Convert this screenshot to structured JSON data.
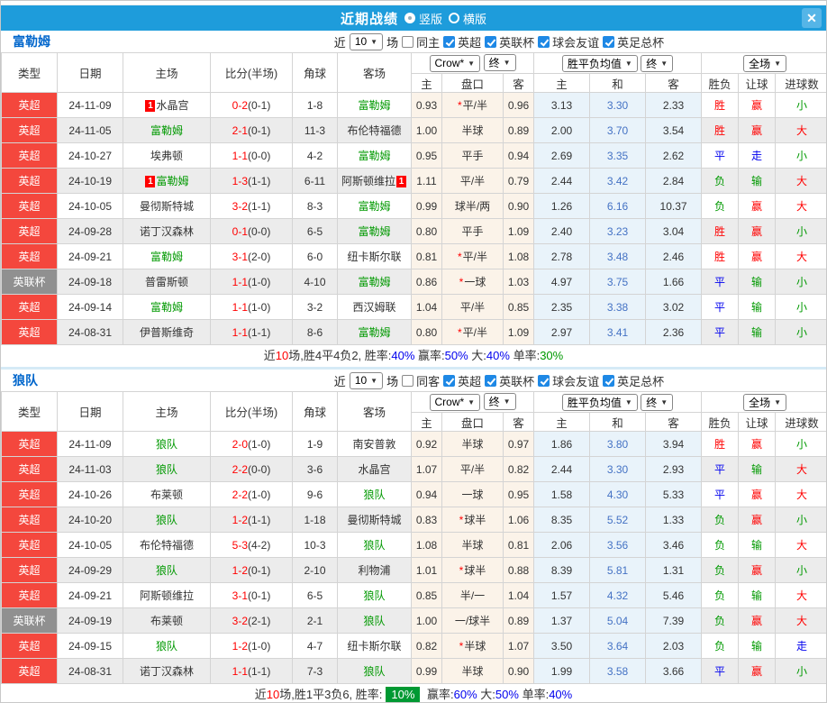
{
  "window": {
    "title": "近期战绩",
    "close_glyph": "✕",
    "layouts": [
      {
        "label": "竖版",
        "selected": true
      },
      {
        "label": "横版",
        "selected": false
      }
    ]
  },
  "colors": {
    "title_bar_blue": "#1e9cdb",
    "league_red": "#f4473d",
    "cup_gray": "#909090",
    "focus_team_green": "#009900",
    "score_red": "#ff0000",
    "result_blue": "#0000ee",
    "avg_col_bg": "#e9f3fa",
    "odds_col_bg": "#fbf3e9",
    "summary_highlight_bg": "#009933"
  },
  "table": {
    "main_cols": [
      "类型",
      "日期",
      "主场",
      "比分(半场)",
      "角球",
      "客场"
    ],
    "sub_cols": [
      "主",
      "盘口",
      "客",
      "主",
      "和",
      "客",
      "胜负",
      "让球",
      "进球数"
    ],
    "selects": {
      "company": "Crow*",
      "company_time": "终",
      "avg": "胜平负均值",
      "avg_time": "终",
      "scope": "全场"
    }
  },
  "type_styles": {
    "英超": "league",
    "英联杯": "cup"
  },
  "result_colors": {
    "胜": "red",
    "平": "blue",
    "负": "green",
    "赢": "red",
    "走": "blue",
    "输": "green",
    "大": "red",
    "小": "green"
  },
  "sections": [
    {
      "team": "富勒姆",
      "filter": {
        "near_label": "近",
        "count": "10",
        "unit_label": "场",
        "same_label": "同主",
        "same_checked": false,
        "competitions": [
          {
            "label": "英超",
            "checked": true
          },
          {
            "label": "英联杯",
            "checked": true
          },
          {
            "label": "球会友谊",
            "checked": true
          },
          {
            "label": "英足总杯",
            "checked": true
          }
        ]
      },
      "rows": [
        {
          "type": "英超",
          "date": "24-11-09",
          "home": "水晶宫",
          "home_green": false,
          "home_badge": "1",
          "score": "0-2",
          "half": "(0-1)",
          "corners": "1-8",
          "away": "富勒姆",
          "away_green": true,
          "odds": [
            "0.93",
            "*平/半",
            "0.96"
          ],
          "avg": [
            "3.13",
            "3.30",
            "2.33"
          ],
          "results": [
            "胜",
            "赢",
            "小"
          ]
        },
        {
          "type": "英超",
          "date": "24-11-05",
          "home": "富勒姆",
          "home_green": true,
          "score": "2-1",
          "half": "(0-1)",
          "corners": "11-3",
          "away": "布伦特福德",
          "away_green": false,
          "odds": [
            "1.00",
            "半球",
            "0.89"
          ],
          "avg": [
            "2.00",
            "3.70",
            "3.54"
          ],
          "results": [
            "胜",
            "赢",
            "大"
          ]
        },
        {
          "type": "英超",
          "date": "24-10-27",
          "home": "埃弗顿",
          "home_green": false,
          "score": "1-1",
          "half": "(0-0)",
          "corners": "4-2",
          "away": "富勒姆",
          "away_green": true,
          "odds": [
            "0.95",
            "平手",
            "0.94"
          ],
          "avg": [
            "2.69",
            "3.35",
            "2.62"
          ],
          "results": [
            "平",
            "走",
            "小"
          ]
        },
        {
          "type": "英超",
          "date": "24-10-19",
          "home": "富勒姆",
          "home_green": true,
          "home_badge": "1",
          "score": "1-3",
          "half": "(1-1)",
          "corners": "6-11",
          "away": "阿斯顿维拉",
          "away_green": false,
          "away_badge": "1",
          "odds": [
            "1.11",
            "平/半",
            "0.79"
          ],
          "avg": [
            "2.44",
            "3.42",
            "2.84"
          ],
          "results": [
            "负",
            "输",
            "大"
          ]
        },
        {
          "type": "英超",
          "date": "24-10-05",
          "home": "曼彻斯特城",
          "home_green": false,
          "score": "3-2",
          "half": "(1-1)",
          "corners": "8-3",
          "away": "富勒姆",
          "away_green": true,
          "odds": [
            "0.99",
            "球半/两",
            "0.90"
          ],
          "avg": [
            "1.26",
            "6.16",
            "10.37"
          ],
          "results": [
            "负",
            "赢",
            "大"
          ]
        },
        {
          "type": "英超",
          "date": "24-09-28",
          "home": "诺丁汉森林",
          "home_green": false,
          "score": "0-1",
          "half": "(0-0)",
          "corners": "6-5",
          "away": "富勒姆",
          "away_green": true,
          "odds": [
            "0.80",
            "平手",
            "1.09"
          ],
          "avg": [
            "2.40",
            "3.23",
            "3.04"
          ],
          "results": [
            "胜",
            "赢",
            "小"
          ]
        },
        {
          "type": "英超",
          "date": "24-09-21",
          "home": "富勒姆",
          "home_green": true,
          "score": "3-1",
          "half": "(2-0)",
          "corners": "6-0",
          "away": "纽卡斯尔联",
          "away_green": false,
          "odds": [
            "0.81",
            "*平/半",
            "1.08"
          ],
          "avg": [
            "2.78",
            "3.48",
            "2.46"
          ],
          "results": [
            "胜",
            "赢",
            "大"
          ]
        },
        {
          "type": "英联杯",
          "date": "24-09-18",
          "home": "普雷斯顿",
          "home_green": false,
          "score": "1-1",
          "half": "(1-0)",
          "corners": "4-10",
          "away": "富勒姆",
          "away_green": true,
          "odds": [
            "0.86",
            "*一球",
            "1.03"
          ],
          "avg": [
            "4.97",
            "3.75",
            "1.66"
          ],
          "results": [
            "平",
            "输",
            "小"
          ]
        },
        {
          "type": "英超",
          "date": "24-09-14",
          "home": "富勒姆",
          "home_green": true,
          "score": "1-1",
          "half": "(1-0)",
          "corners": "3-2",
          "away": "西汉姆联",
          "away_green": false,
          "odds": [
            "1.04",
            "平/半",
            "0.85"
          ],
          "avg": [
            "2.35",
            "3.38",
            "3.02"
          ],
          "results": [
            "平",
            "输",
            "小"
          ]
        },
        {
          "type": "英超",
          "date": "24-08-31",
          "home": "伊普斯维奇",
          "home_green": false,
          "score": "1-1",
          "half": "(1-1)",
          "corners": "8-6",
          "away": "富勒姆",
          "away_green": true,
          "odds": [
            "0.80",
            "*平/半",
            "1.09"
          ],
          "avg": [
            "2.97",
            "3.41",
            "2.36"
          ],
          "results": [
            "平",
            "输",
            "小"
          ]
        }
      ],
      "summary": {
        "segments": [
          {
            "t": "近",
            "c": "dark"
          },
          {
            "t": "10",
            "c": "red"
          },
          {
            "t": "场,胜4平4负2, 胜率:",
            "c": "dark"
          },
          {
            "t": "40%",
            "c": "blue"
          },
          {
            "t": " 赢率:",
            "c": "dark"
          },
          {
            "t": "50%",
            "c": "blue"
          },
          {
            "t": " 大:",
            "c": "dark"
          },
          {
            "t": "40%",
            "c": "blue"
          },
          {
            "t": " 单率:",
            "c": "dark"
          },
          {
            "t": "30%",
            "c": "green"
          }
        ]
      }
    },
    {
      "team": "狼队",
      "filter": {
        "near_label": "近",
        "count": "10",
        "unit_label": "场",
        "same_label": "同客",
        "same_checked": false,
        "competitions": [
          {
            "label": "英超",
            "checked": true
          },
          {
            "label": "英联杯",
            "checked": true
          },
          {
            "label": "球会友谊",
            "checked": true
          },
          {
            "label": "英足总杯",
            "checked": true
          }
        ]
      },
      "rows": [
        {
          "type": "英超",
          "date": "24-11-09",
          "home": "狼队",
          "home_green": true,
          "score": "2-0",
          "half": "(1-0)",
          "corners": "1-9",
          "away": "南安普敦",
          "away_green": false,
          "odds": [
            "0.92",
            "半球",
            "0.97"
          ],
          "avg": [
            "1.86",
            "3.80",
            "3.94"
          ],
          "results": [
            "胜",
            "赢",
            "小"
          ]
        },
        {
          "type": "英超",
          "date": "24-11-03",
          "home": "狼队",
          "home_green": true,
          "score": "2-2",
          "half": "(0-0)",
          "corners": "3-6",
          "away": "水晶宫",
          "away_green": false,
          "odds": [
            "1.07",
            "平/半",
            "0.82"
          ],
          "avg": [
            "2.44",
            "3.30",
            "2.93"
          ],
          "results": [
            "平",
            "输",
            "大"
          ]
        },
        {
          "type": "英超",
          "date": "24-10-26",
          "home": "布莱顿",
          "home_green": false,
          "score": "2-2",
          "half": "(1-0)",
          "corners": "9-6",
          "away": "狼队",
          "away_green": true,
          "odds": [
            "0.94",
            "一球",
            "0.95"
          ],
          "avg": [
            "1.58",
            "4.30",
            "5.33"
          ],
          "results": [
            "平",
            "赢",
            "大"
          ]
        },
        {
          "type": "英超",
          "date": "24-10-20",
          "home": "狼队",
          "home_green": true,
          "score": "1-2",
          "half": "(1-1)",
          "corners": "1-18",
          "away": "曼彻斯特城",
          "away_green": false,
          "odds": [
            "0.83",
            "*球半",
            "1.06"
          ],
          "avg": [
            "8.35",
            "5.52",
            "1.33"
          ],
          "results": [
            "负",
            "赢",
            "小"
          ]
        },
        {
          "type": "英超",
          "date": "24-10-05",
          "home": "布伦特福德",
          "home_green": false,
          "score": "5-3",
          "half": "(4-2)",
          "corners": "10-3",
          "away": "狼队",
          "away_green": true,
          "odds": [
            "1.08",
            "半球",
            "0.81"
          ],
          "avg": [
            "2.06",
            "3.56",
            "3.46"
          ],
          "results": [
            "负",
            "输",
            "大"
          ]
        },
        {
          "type": "英超",
          "date": "24-09-29",
          "home": "狼队",
          "home_green": true,
          "score": "1-2",
          "half": "(0-1)",
          "corners": "2-10",
          "away": "利物浦",
          "away_green": false,
          "odds": [
            "1.01",
            "*球半",
            "0.88"
          ],
          "avg": [
            "8.39",
            "5.81",
            "1.31"
          ],
          "results": [
            "负",
            "赢",
            "小"
          ]
        },
        {
          "type": "英超",
          "date": "24-09-21",
          "home": "阿斯顿维拉",
          "home_green": false,
          "score": "3-1",
          "half": "(0-1)",
          "corners": "6-5",
          "away": "狼队",
          "away_green": true,
          "odds": [
            "0.85",
            "半/一",
            "1.04"
          ],
          "avg": [
            "1.57",
            "4.32",
            "5.46"
          ],
          "results": [
            "负",
            "输",
            "大"
          ]
        },
        {
          "type": "英联杯",
          "date": "24-09-19",
          "home": "布莱顿",
          "home_green": false,
          "score": "3-2",
          "half": "(2-1)",
          "corners": "2-1",
          "away": "狼队",
          "away_green": true,
          "odds": [
            "1.00",
            "一/球半",
            "0.89"
          ],
          "avg": [
            "1.37",
            "5.04",
            "7.39"
          ],
          "results": [
            "负",
            "赢",
            "大"
          ]
        },
        {
          "type": "英超",
          "date": "24-09-15",
          "home": "狼队",
          "home_green": true,
          "score": "1-2",
          "half": "(1-0)",
          "corners": "4-7",
          "away": "纽卡斯尔联",
          "away_green": false,
          "odds": [
            "0.82",
            "*半球",
            "1.07"
          ],
          "avg": [
            "3.50",
            "3.64",
            "2.03"
          ],
          "results": [
            "负",
            "输",
            "走"
          ]
        },
        {
          "type": "英超",
          "date": "24-08-31",
          "home": "诺丁汉森林",
          "home_green": false,
          "score": "1-1",
          "half": "(1-1)",
          "corners": "7-3",
          "away": "狼队",
          "away_green": true,
          "odds": [
            "0.99",
            "半球",
            "0.90"
          ],
          "avg": [
            "1.99",
            "3.58",
            "3.66"
          ],
          "results": [
            "平",
            "赢",
            "小"
          ]
        }
      ],
      "summary": {
        "segments": [
          {
            "t": "近",
            "c": "dark"
          },
          {
            "t": "10",
            "c": "red"
          },
          {
            "t": "场,胜1平3负6, 胜率:",
            "c": "dark"
          },
          {
            "t": "10%",
            "c": "highlight"
          },
          {
            "t": " 赢率:",
            "c": "dark"
          },
          {
            "t": "60%",
            "c": "blue"
          },
          {
            "t": " 大:",
            "c": "dark"
          },
          {
            "t": "50%",
            "c": "blue"
          },
          {
            "t": " 单率:",
            "c": "dark"
          },
          {
            "t": "40%",
            "c": "blue"
          }
        ]
      }
    }
  ]
}
